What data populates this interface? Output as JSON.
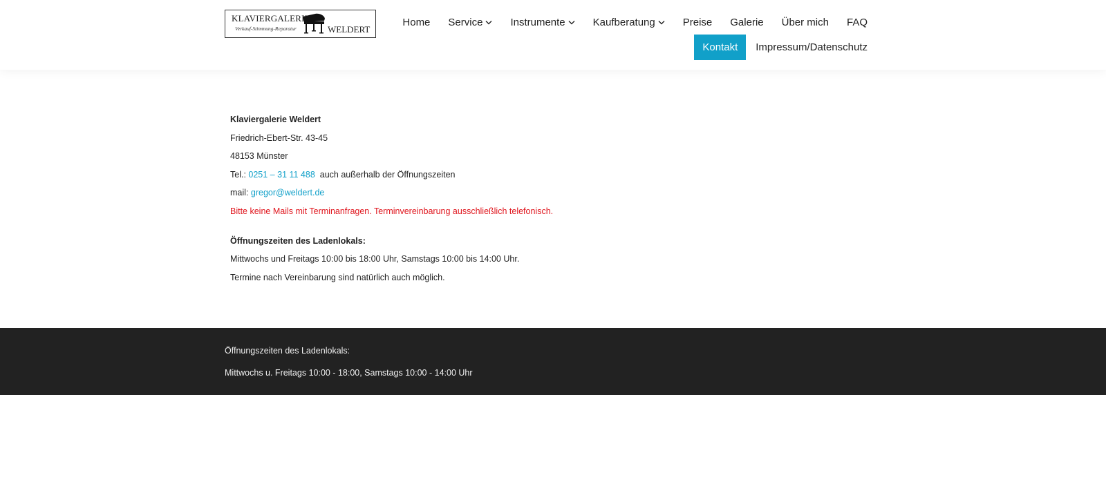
{
  "logo": {
    "line1": "KLAVIERGALERIE",
    "line2": "Verkauf-Stimmung-Reparatur",
    "line3": "WELDERT",
    "icon": "grand-piano-icon"
  },
  "nav": {
    "row1": [
      {
        "label": "Home",
        "dropdown": false
      },
      {
        "label": "Service",
        "dropdown": true
      },
      {
        "label": "Instrumente",
        "dropdown": true
      },
      {
        "label": "Kaufberatung",
        "dropdown": true
      },
      {
        "label": "Preise",
        "dropdown": false
      },
      {
        "label": "Galerie",
        "dropdown": false
      },
      {
        "label": "Über mich",
        "dropdown": false
      },
      {
        "label": "FAQ",
        "dropdown": false
      }
    ],
    "row2": [
      {
        "label": "Kontakt",
        "active": true
      },
      {
        "label": "Impressum/Datenschutz",
        "active": false
      }
    ]
  },
  "contact": {
    "company": "Klaviergalerie Weldert",
    "street": "Friedrich-Ebert-Str. 43-45",
    "city": "48153 Münster",
    "tel_prefix": "Tel.: ",
    "tel": "0251 – 31 11 488",
    "tel_suffix": "  auch außerhalb der Öffnungszeiten",
    "mail_prefix": "mail: ",
    "mail": "gregor@weldert.de",
    "notice": "Bitte keine Mails mit Terminanfragen. Terminvereinbarung ausschließlich telefonisch.",
    "hours_title": "Öffnungszeiten des Ladenlokals:",
    "hours": "Mittwochs und Freitags 10:00 bis 18:00 Uhr, Samstags 10:00 bis 14:00 Uhr.",
    "appointment": "Termine nach Vereinbarung sind natürlich auch möglich."
  },
  "footer": {
    "title": "Öffnungszeiten des Ladenlokals:",
    "hours": "Mittwochs u. Freitags 10:00 - 18:00, Samstags 10:00 - 14:00 Uhr"
  },
  "colors": {
    "accent": "#11a0c9",
    "notice": "#e0161e",
    "footer_bg": "#222222"
  }
}
